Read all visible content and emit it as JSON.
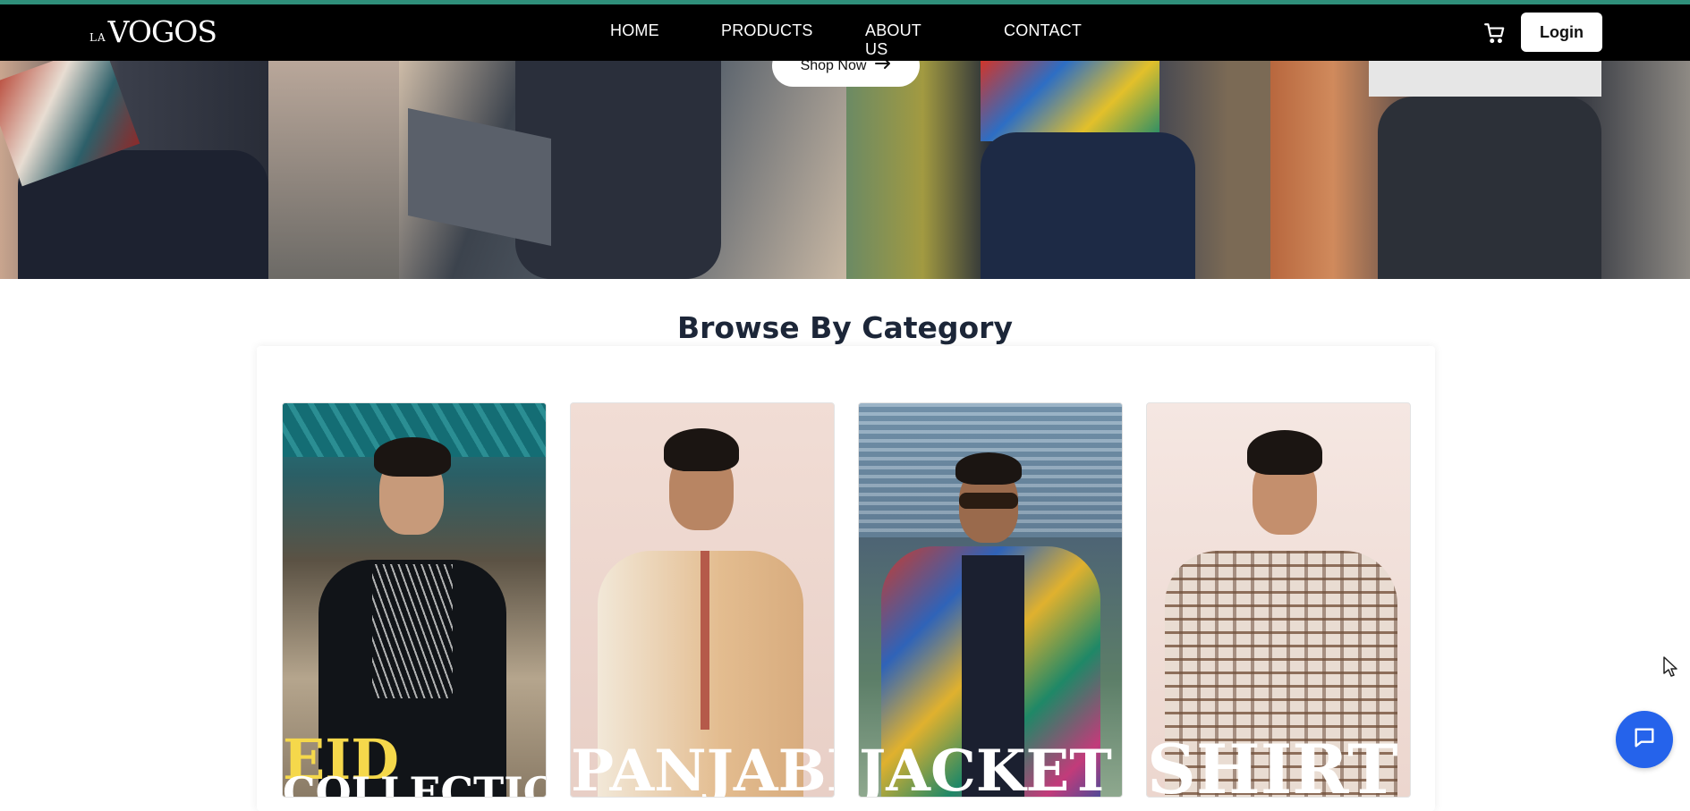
{
  "brand": {
    "prefix": "LA",
    "name": "VOGOS"
  },
  "nav": {
    "items": [
      {
        "label": "HOME"
      },
      {
        "label": "PRODUCTS"
      },
      {
        "label": "ABOUT US"
      },
      {
        "label": "CONTACT"
      }
    ],
    "cart_icon": "cart-icon",
    "login_label": "Login"
  },
  "hero": {
    "button_label": "Shop Now",
    "button_icon": "arrow-right-icon",
    "slide_count": 3,
    "active_slide": 2
  },
  "section": {
    "title": "Browse By Category"
  },
  "categories": [
    {
      "line1": "EID",
      "line2": "COLLECTION",
      "accent": "#f5d84b"
    },
    {
      "line1": "PANJABI",
      "line2": ""
    },
    {
      "line1": "JACKET",
      "line2": ""
    },
    {
      "line1": "SHIRT",
      "line2": ""
    }
  ],
  "chat": {
    "icon": "chat-bubble-icon"
  },
  "colors": {
    "accent_bar": "#2f8f7a",
    "active_dot": "#d33838",
    "chat_button": "#2563eb",
    "heading": "#1c2638"
  }
}
